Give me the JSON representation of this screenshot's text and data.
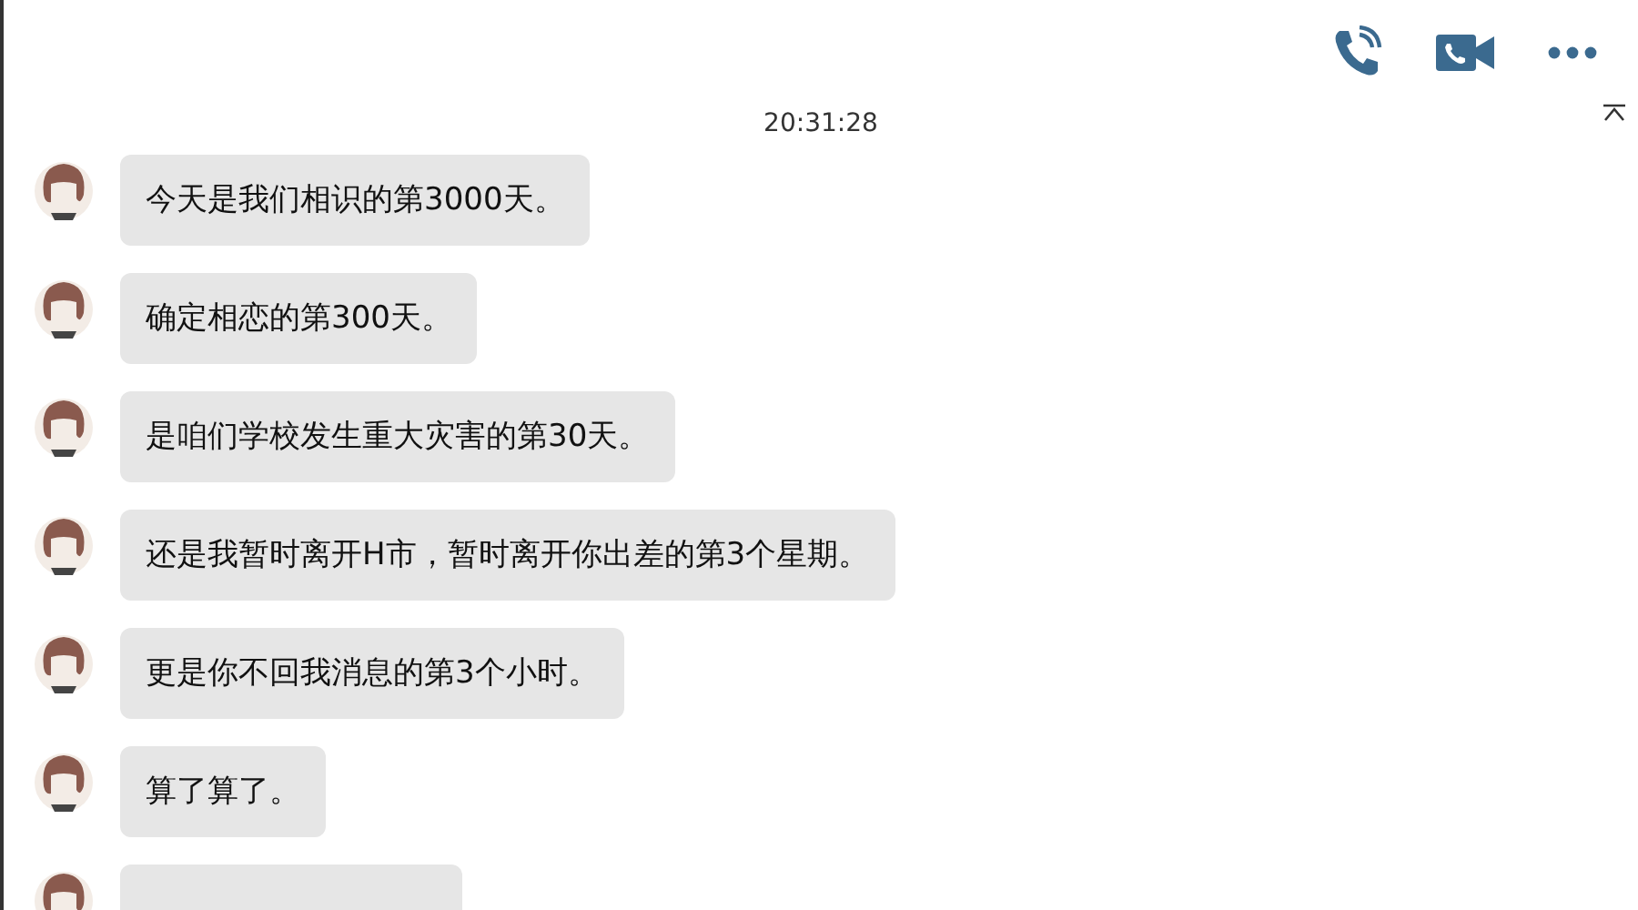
{
  "timestamp": "20:31:28",
  "messages": [
    {
      "kind": "text",
      "text": "今天是我们相识的第3000天。"
    },
    {
      "kind": "text",
      "text": "确定相恋的第300天。"
    },
    {
      "kind": "text",
      "text": "是咱们学校发生重大灾害的第30天。"
    },
    {
      "kind": "text",
      "text": "还是我暂时离开H市，暂时离开你出差的第3个星期。"
    },
    {
      "kind": "text",
      "text": "更是你不回我消息的第3个小时。"
    },
    {
      "kind": "text",
      "text": "算了算了。"
    },
    {
      "kind": "cut"
    }
  ]
}
